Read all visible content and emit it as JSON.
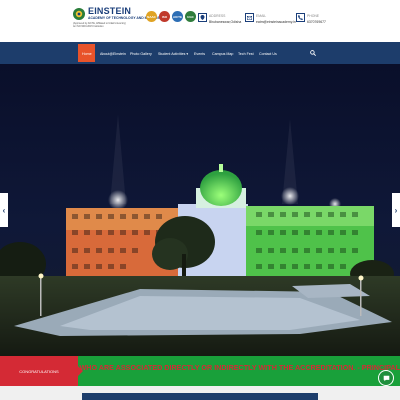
{
  "header": {
    "logo_name": "EINSTEIN",
    "logo_tagline": "ACADEMY OF TECHNOLOGY AND MANAGEMENT",
    "logo_line1": "(Approved by AICTE, Affiliated to Utkal University)",
    "logo_line2": "An ISO 9001:2015 Institution",
    "badges": [
      "NAAC",
      "ISO",
      "AICTE",
      "UGC"
    ],
    "address_label": "ADDRESS",
    "address_value": "Bhubaneswar,Odisha",
    "email_label": "EMAIL",
    "email_value": "eatm@einsteinacademy.in",
    "phone_label": "PHONE",
    "phone_value": "6370769677"
  },
  "nav": {
    "items": [
      "Home",
      "About@Einstein",
      "Photo Gallery",
      "Student Activities ▾",
      "Events",
      "Campus Map",
      "Tech Fest",
      "Contact Us"
    ]
  },
  "ticker": {
    "label": "CONGRATULATIONS",
    "text": "CONGRATULATIONS TO ALL THOSE WHO ARE ASSOCIATED DIRECTLY OR INDIRECTLY WITH THE ACCREDITATION. - PRINCIPAL"
  },
  "colors": {
    "nav_bg": "#1d3d6b",
    "nav_active": "#e8532a",
    "ticker_bg": "#19a03a",
    "ticker_label_bg": "#d42a35"
  },
  "icons": {
    "address": "map-marker-icon",
    "email": "envelope-icon",
    "phone": "phone-icon",
    "search": "search-icon",
    "chat": "chat-icon"
  }
}
